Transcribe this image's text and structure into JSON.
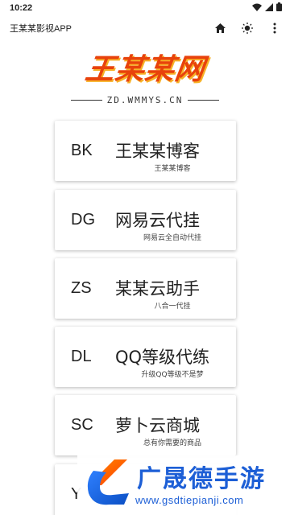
{
  "status_bar": {
    "time": "10:22",
    "icons": [
      "wifi-icon",
      "signal-icon",
      "battery-icon"
    ]
  },
  "app_bar": {
    "title": "王某某影视APP",
    "actions": [
      "home-icon",
      "brightness-icon",
      "more-vert-icon"
    ]
  },
  "logo": {
    "text": "王某某网",
    "subtitle": "ZD.WMMYS.CN",
    "colors": {
      "primary": "#e8420b",
      "accent": "#f7b227"
    }
  },
  "cards": [
    {
      "code": "BK",
      "title": "王某某博客",
      "desc": "王某某博客"
    },
    {
      "code": "DG",
      "title": "网易云代挂",
      "desc": "网易云全自动代挂"
    },
    {
      "code": "ZS",
      "title": "某某云助手",
      "desc": "八合一代挂"
    },
    {
      "code": "DL",
      "title": "QQ等级代练",
      "desc": "升级QQ等级不是梦"
    },
    {
      "code": "SC",
      "title": "萝卜云商城",
      "desc": "总有你需要的商品"
    },
    {
      "code": "Y",
      "title": "",
      "desc": ""
    }
  ],
  "watermark": {
    "brand": "广晟德手游",
    "url": "www.gsdtiepianji.com",
    "color": "#1d5fd6"
  }
}
